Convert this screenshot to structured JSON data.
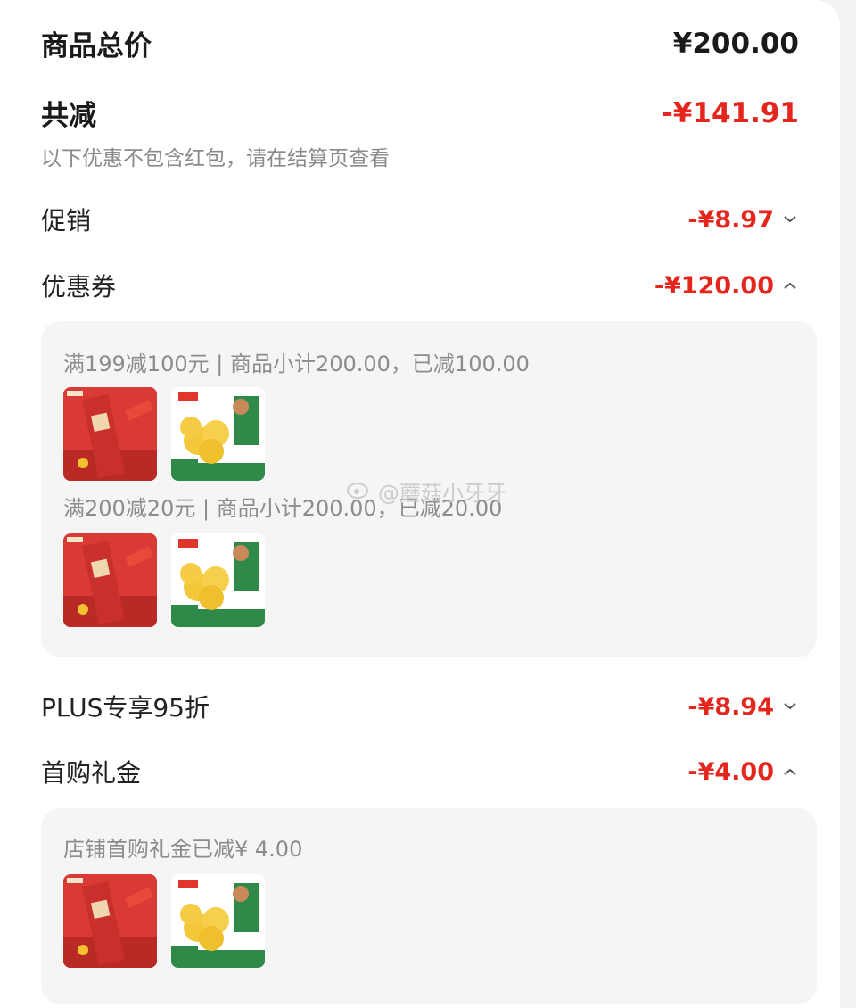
{
  "summary": {
    "total_label": "商品总价",
    "total_value": "¥200.00",
    "discount_label": "共减",
    "discount_value": "-¥141.91",
    "note": "以下优惠不包含红包，请在结算页查看"
  },
  "rows": {
    "promo": {
      "label": "促销",
      "value": "-¥8.97",
      "chevron": "chevron-down-icon"
    },
    "coupon": {
      "label": "优惠券",
      "value": "-¥120.00",
      "chevron": "chevron-up-icon"
    },
    "plus": {
      "label": "PLUS专享95折",
      "value": "-¥8.94",
      "chevron": "chevron-down-icon"
    },
    "first_gift": {
      "label": "首购礼金",
      "value": "-¥4.00",
      "chevron": "chevron-up-icon"
    }
  },
  "coupon_details": [
    {
      "text": "满199减100元 | 商品小计200.00，已减100.00"
    },
    {
      "text": "满200减20元 | 商品小计200.00，已减20.00"
    }
  ],
  "gift_detail": {
    "text": "店铺首购礼金已减¥ 4.00"
  },
  "products": [
    "product-red-gift-box",
    "product-yellow-pastry-box"
  ],
  "watermark": "@蘑菇小牙牙",
  "colors": {
    "accent": "#e4261d",
    "panel": "#f5f5f5",
    "muted": "#8c8c8c"
  }
}
